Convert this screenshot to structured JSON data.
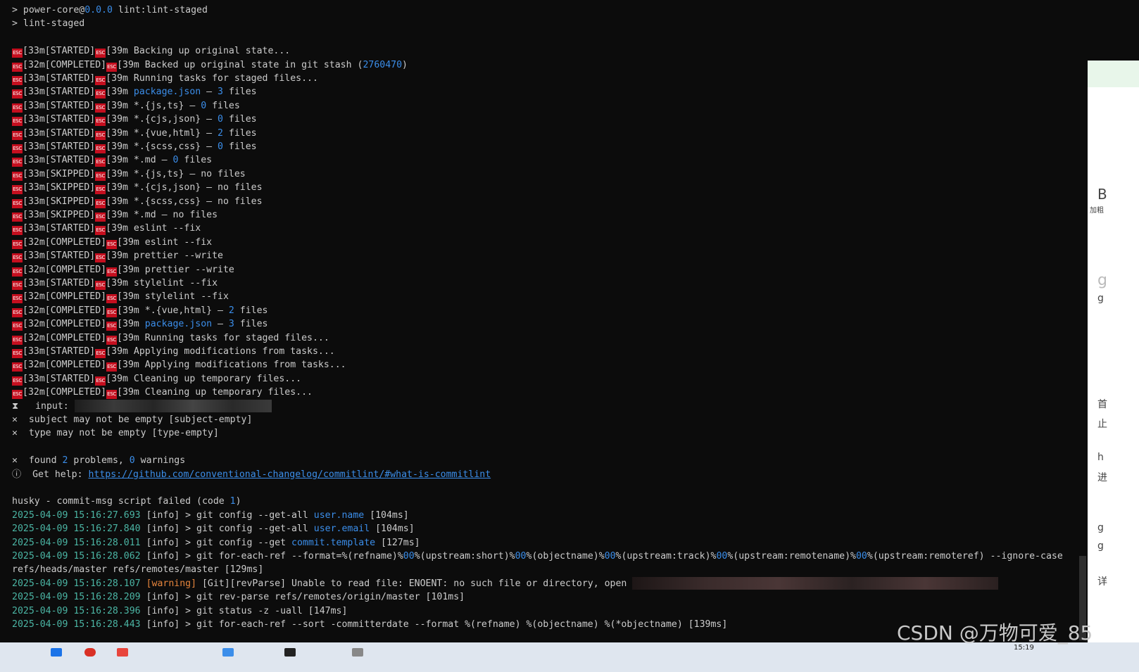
{
  "terminal": {
    "header": [
      {
        "parts": [
          {
            "t": "> power-core"
          },
          {
            "t": "@",
            "c": ""
          },
          {
            "t": "0.0.0",
            "c": "num"
          },
          {
            "t": " lint:lint-staged"
          }
        ]
      },
      {
        "parts": [
          {
            "t": "> lint-staged"
          }
        ]
      }
    ],
    "esc_label": "ESC",
    "lint_lines": [
      {
        "code": "[33m",
        "status": "[STARTED]",
        "mid": "[39m",
        "parts": [
          {
            "t": "Backing up original state..."
          }
        ]
      },
      {
        "code": "[32m",
        "status": "[COMPLETED]",
        "mid": "[39m",
        "parts": [
          {
            "t": "Backed up original state in git stash ("
          },
          {
            "t": "2760470",
            "c": "num"
          },
          {
            "t": ")"
          }
        ]
      },
      {
        "code": "[33m",
        "status": "[STARTED]",
        "mid": "[39m",
        "parts": [
          {
            "t": "Running tasks for staged files..."
          }
        ]
      },
      {
        "code": "[33m",
        "status": "[STARTED]",
        "mid": "[39m",
        "parts": [
          {
            "t": "package.json",
            "c": "num"
          },
          {
            "t": " — "
          },
          {
            "t": "3",
            "c": "num"
          },
          {
            "t": " files"
          }
        ]
      },
      {
        "code": "[33m",
        "status": "[STARTED]",
        "mid": "[39m",
        "parts": [
          {
            "t": "*.{js,ts} — "
          },
          {
            "t": "0",
            "c": "num"
          },
          {
            "t": " files"
          }
        ]
      },
      {
        "code": "[33m",
        "status": "[STARTED]",
        "mid": "[39m",
        "parts": [
          {
            "t": "*.{cjs,json} — "
          },
          {
            "t": "0",
            "c": "num"
          },
          {
            "t": " files"
          }
        ]
      },
      {
        "code": "[33m",
        "status": "[STARTED]",
        "mid": "[39m",
        "parts": [
          {
            "t": "*.{vue,html} — "
          },
          {
            "t": "2",
            "c": "num"
          },
          {
            "t": " files"
          }
        ]
      },
      {
        "code": "[33m",
        "status": "[STARTED]",
        "mid": "[39m",
        "parts": [
          {
            "t": "*.{scss,css} — "
          },
          {
            "t": "0",
            "c": "num"
          },
          {
            "t": " files"
          }
        ]
      },
      {
        "code": "[33m",
        "status": "[STARTED]",
        "mid": "[39m",
        "parts": [
          {
            "t": "*.md — "
          },
          {
            "t": "0",
            "c": "num"
          },
          {
            "t": " files"
          }
        ]
      },
      {
        "code": "[33m",
        "status": "[SKIPPED]",
        "mid": "[39m",
        "parts": [
          {
            "t": "*.{js,ts} — no files"
          }
        ]
      },
      {
        "code": "[33m",
        "status": "[SKIPPED]",
        "mid": "[39m",
        "parts": [
          {
            "t": "*.{cjs,json} — no files"
          }
        ]
      },
      {
        "code": "[33m",
        "status": "[SKIPPED]",
        "mid": "[39m",
        "parts": [
          {
            "t": "*.{scss,css} — no files"
          }
        ]
      },
      {
        "code": "[33m",
        "status": "[SKIPPED]",
        "mid": "[39m",
        "parts": [
          {
            "t": "*.md — no files"
          }
        ]
      },
      {
        "code": "[33m",
        "status": "[STARTED]",
        "mid": "[39m",
        "parts": [
          {
            "t": "eslint --fix"
          }
        ]
      },
      {
        "code": "[32m",
        "status": "[COMPLETED]",
        "mid": "[39m",
        "parts": [
          {
            "t": "eslint --fix"
          }
        ]
      },
      {
        "code": "[33m",
        "status": "[STARTED]",
        "mid": "[39m",
        "parts": [
          {
            "t": "prettier --write"
          }
        ]
      },
      {
        "code": "[32m",
        "status": "[COMPLETED]",
        "mid": "[39m",
        "parts": [
          {
            "t": "prettier --write"
          }
        ]
      },
      {
        "code": "[33m",
        "status": "[STARTED]",
        "mid": "[39m",
        "parts": [
          {
            "t": "stylelint --fix"
          }
        ]
      },
      {
        "code": "[32m",
        "status": "[COMPLETED]",
        "mid": "[39m",
        "parts": [
          {
            "t": "stylelint --fix"
          }
        ]
      },
      {
        "code": "[32m",
        "status": "[COMPLETED]",
        "mid": "[39m",
        "parts": [
          {
            "t": "*.{vue,html} — "
          },
          {
            "t": "2",
            "c": "num"
          },
          {
            "t": " files"
          }
        ]
      },
      {
        "code": "[32m",
        "status": "[COMPLETED]",
        "mid": "[39m",
        "parts": [
          {
            "t": "package.json",
            "c": "num"
          },
          {
            "t": " — "
          },
          {
            "t": "3",
            "c": "num"
          },
          {
            "t": " files"
          }
        ]
      },
      {
        "code": "[32m",
        "status": "[COMPLETED]",
        "mid": "[39m",
        "parts": [
          {
            "t": "Running tasks for staged files..."
          }
        ]
      },
      {
        "code": "[33m",
        "status": "[STARTED]",
        "mid": "[39m",
        "parts": [
          {
            "t": "Applying modifications from tasks..."
          }
        ]
      },
      {
        "code": "[32m",
        "status": "[COMPLETED]",
        "mid": "[39m",
        "parts": [
          {
            "t": "Applying modifications from tasks..."
          }
        ]
      },
      {
        "code": "[33m",
        "status": "[STARTED]",
        "mid": "[39m",
        "parts": [
          {
            "t": "Cleaning up temporary files..."
          }
        ]
      },
      {
        "code": "[32m",
        "status": "[COMPLETED]",
        "mid": "[39m",
        "parts": [
          {
            "t": "Cleaning up temporary files..."
          }
        ]
      }
    ],
    "commitlint": {
      "input_symbol": "⧗",
      "input_label": "input:",
      "errors": [
        {
          "symbol": "✕",
          "text": "subject may not be empty [subject-empty]"
        },
        {
          "symbol": "✕",
          "text": "type may not be empty [type-empty]"
        }
      ],
      "summary_symbol": "✕",
      "summary_parts": [
        {
          "t": "found "
        },
        {
          "t": "2",
          "c": "num"
        },
        {
          "t": " problems, "
        },
        {
          "t": "0",
          "c": "num"
        },
        {
          "t": " warnings"
        }
      ],
      "help_symbol": "ⓘ",
      "help_label": "Get help: ",
      "help_url": "https://github.com/conventional-changelog/commitlint/#what-is-commitlint"
    },
    "husky_parts": [
      {
        "t": "husky - commit-msg script failed (code "
      },
      {
        "t": "1",
        "c": "num"
      },
      {
        "t": ")"
      }
    ],
    "git_log": [
      {
        "time": "2025-04-09 15:16:27.693",
        "level": "[info]",
        "parts": [
          {
            "t": "> git config --get-all "
          },
          {
            "t": "user.name",
            "c": "num"
          },
          {
            "t": " [104ms]"
          }
        ]
      },
      {
        "time": "2025-04-09 15:16:27.840",
        "level": "[info]",
        "parts": [
          {
            "t": "> git config --get-all "
          },
          {
            "t": "user.email",
            "c": "num"
          },
          {
            "t": " [104ms]"
          }
        ]
      },
      {
        "time": "2025-04-09 15:16:28.011",
        "level": "[info]",
        "parts": [
          {
            "t": "> git config --get "
          },
          {
            "t": "commit.template",
            "c": "num"
          },
          {
            "t": " [127ms]"
          }
        ]
      },
      {
        "time": "2025-04-09 15:16:28.062",
        "level": "[info]",
        "parts": [
          {
            "t": "> git for-each-ref --format=%(refname)%"
          },
          {
            "t": "00",
            "c": "num"
          },
          {
            "t": "%(upstream:short)%"
          },
          {
            "t": "00",
            "c": "num"
          },
          {
            "t": "%(objectname)%"
          },
          {
            "t": "00",
            "c": "num"
          },
          {
            "t": "%(upstream:track)%"
          },
          {
            "t": "00",
            "c": "num"
          },
          {
            "t": "%(upstream:remotename)%"
          },
          {
            "t": "00",
            "c": "num"
          },
          {
            "t": "%(upstream:remoteref) --ignore-case"
          }
        ]
      },
      {
        "time": "",
        "level": "",
        "parts": [
          {
            "t": "refs/heads/master refs/remotes/master [129ms]"
          }
        ]
      },
      {
        "time": "2025-04-09 15:16:28.107",
        "level": "[warning]",
        "warn": true,
        "parts": [
          {
            "t": "[Git][revParse] Unable to read file: ENOENT: no such file or directory, open "
          }
        ]
      },
      {
        "time": "2025-04-09 15:16:28.209",
        "level": "[info]",
        "parts": [
          {
            "t": "> git rev-parse refs/remotes/origin/master [101ms]"
          }
        ]
      },
      {
        "time": "2025-04-09 15:16:28.396",
        "level": "[info]",
        "parts": [
          {
            "t": "> git status -z -uall [147ms]"
          }
        ]
      },
      {
        "time": "2025-04-09 15:16:28.443",
        "level": "[info]",
        "parts": [
          {
            "t": "> git for-each-ref --sort -committerdate --format %(refname) %(objectname) %(*objectname) [139ms]"
          }
        ]
      }
    ]
  },
  "side_panel": {
    "chars": [
      "B",
      "加粗",
      "g",
      "g",
      "首",
      "止",
      "h",
      "进",
      "g",
      "g",
      "详"
    ]
  },
  "taskbar": {
    "clock": "15:19"
  },
  "watermark": "CSDN @万物可爱_85"
}
